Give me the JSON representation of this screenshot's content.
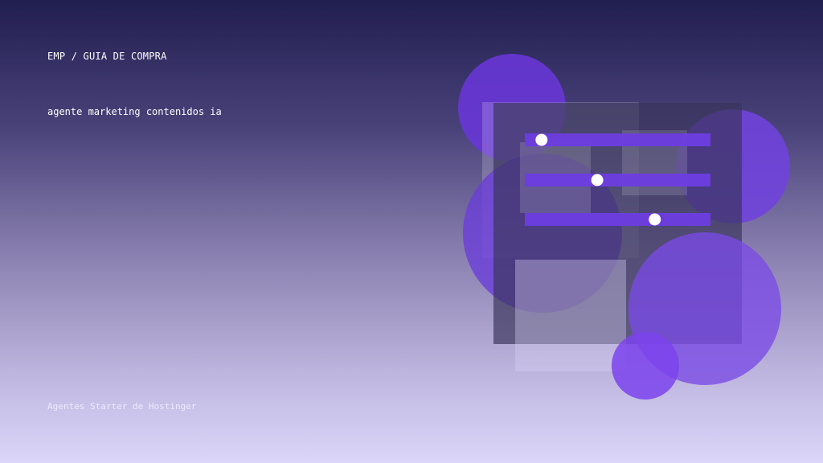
{
  "header": {
    "eyebrow": "EMP / GUIA DE COMPRA",
    "headline": "agente marketing contenidos ia"
  },
  "footer": {
    "brand_line": "Agentes Starter de Hostinger"
  },
  "colors": {
    "accent_purple": "#6a3fd9",
    "panel_dark": "#3c375f",
    "slider_bar": "#6d3de0",
    "slider_knob": "#ffffff"
  },
  "sliders": [
    {
      "value": 0.09
    },
    {
      "value": 0.39
    },
    {
      "value": 0.7
    }
  ]
}
